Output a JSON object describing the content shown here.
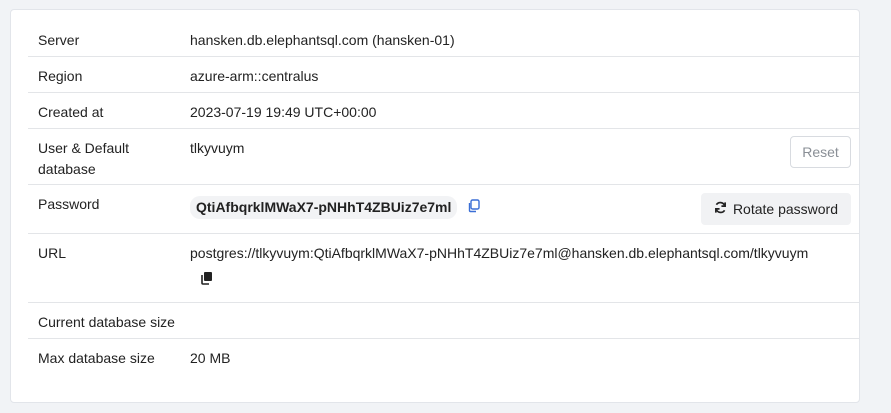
{
  "rows": {
    "server": {
      "label": "Server",
      "value": "hansken.db.elephantsql.com (hansken-01)"
    },
    "region": {
      "label": "Region",
      "value": "azure-arm::centralus"
    },
    "created": {
      "label": "Created at",
      "value": "2023-07-19 19:49 UTC+00:00"
    },
    "user": {
      "label_line1": "User & Default",
      "label_line2": "database",
      "value": "tlkyvuym",
      "reset_label": "Reset"
    },
    "password": {
      "label": "Password",
      "value": "QtiAfbqrklMWaX7-pNHhT4ZBUiz7e7ml",
      "rotate_label": "Rotate password"
    },
    "url": {
      "label": "URL",
      "value": "postgres://tlkyvuym:QtiAfbqrklMWaX7-pNHhT4ZBUiz7e7ml@hansken.db.elephantsql.com/tlkyvuym"
    },
    "current_size": {
      "label": "Current database size",
      "value": ""
    },
    "max_size": {
      "label": "Max database size",
      "value": "20 MB"
    }
  },
  "icons": {
    "copy": "copy-icon",
    "rotate": "refresh-icon"
  },
  "colors": {
    "accent": "#3b6fd6",
    "divider": "#e3e5e8",
    "background": "#f1f3f6"
  }
}
